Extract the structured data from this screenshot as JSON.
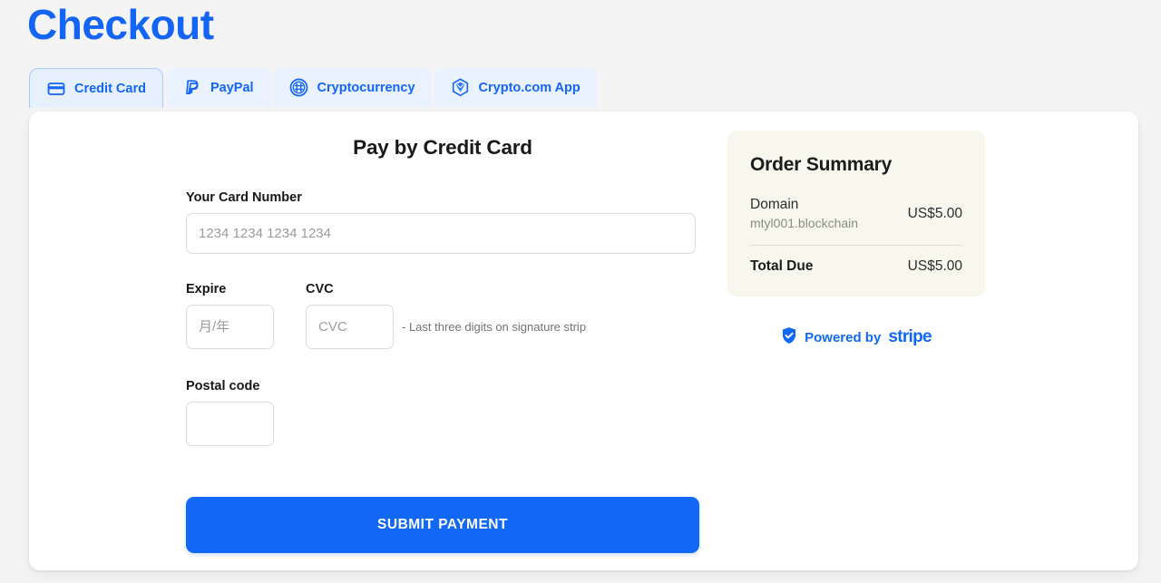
{
  "page": {
    "title": "Checkout",
    "accent_color": "#1464f6",
    "background_color": "#f4f4f4"
  },
  "tabs": [
    {
      "label": "Credit Card",
      "icon": "credit-card-icon",
      "active": true
    },
    {
      "label": "PayPal",
      "icon": "paypal-icon",
      "active": false
    },
    {
      "label": "Cryptocurrency",
      "icon": "crypto-coin-icon",
      "active": false
    },
    {
      "label": "Crypto.com App",
      "icon": "crypto-com-icon",
      "active": false
    }
  ],
  "form": {
    "heading": "Pay by Credit Card",
    "card_number": {
      "label": "Your Card Number",
      "placeholder": "1234 1234 1234 1234",
      "value": ""
    },
    "expire": {
      "label": "Expire",
      "placeholder": "月/年",
      "value": ""
    },
    "cvc": {
      "label": "CVC",
      "placeholder": "CVC",
      "value": "",
      "hint": "- Last three digits on signature strip"
    },
    "postal_code": {
      "label": "Postal code",
      "placeholder": "",
      "value": ""
    },
    "submit_label": "SUBMIT PAYMENT",
    "submit_color": "#1068f5"
  },
  "order_summary": {
    "title": "Order Summary",
    "card_color": "#f7f7ed",
    "items": [
      {
        "name": "Domain",
        "detail": "mtyl001.blockchain",
        "price": "US$5.00"
      }
    ],
    "total_label": "Total Due",
    "total_value": "US$5.00"
  },
  "stripe_badge": {
    "shield_icon": "shield-check-icon",
    "powered_by": "Powered by",
    "brand": "stripe",
    "color": "#1068f5"
  }
}
